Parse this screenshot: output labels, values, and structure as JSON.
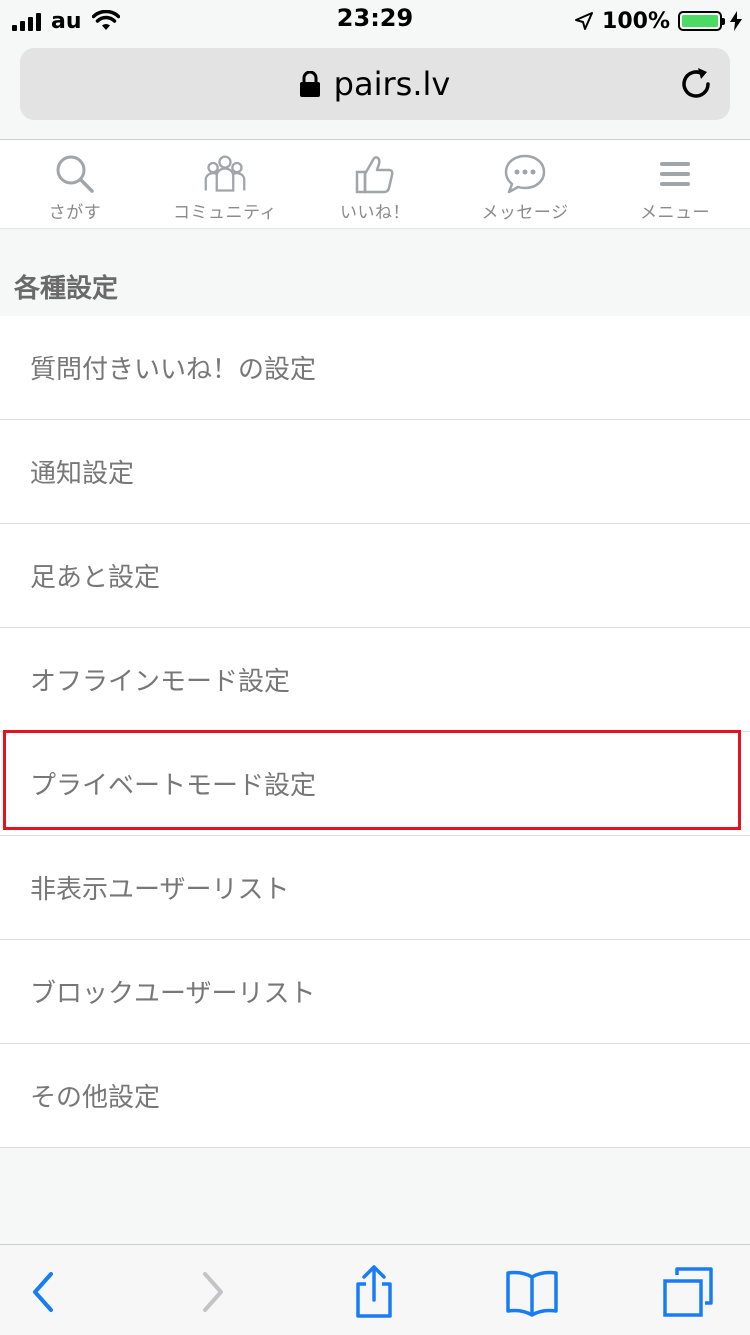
{
  "status_bar": {
    "carrier": "au",
    "time": "23:29",
    "battery_percent": "100%",
    "battery_level": 1.0,
    "battery_color": "#4cd964"
  },
  "browser": {
    "url": "pairs.lv",
    "lock_icon": "lock-icon",
    "reload_icon": "reload-icon"
  },
  "nav": {
    "items": [
      {
        "label": "さがす",
        "icon": "search-icon"
      },
      {
        "label": "コミュニティ",
        "icon": "people-icon"
      },
      {
        "label": "いいね！",
        "icon": "thumbs-up-icon"
      },
      {
        "label": "メッセージ",
        "icon": "chat-bubble-icon"
      },
      {
        "label": "メニュー",
        "icon": "hamburger-icon"
      }
    ]
  },
  "settings": {
    "section_title": "各種設定",
    "items": [
      {
        "label": "質問付きいいね！の設定"
      },
      {
        "label": "通知設定"
      },
      {
        "label": "足あと設定"
      },
      {
        "label": "オフラインモード設定"
      },
      {
        "label": "プライベートモード設定",
        "highlighted": true
      },
      {
        "label": "非表示ユーザーリスト"
      },
      {
        "label": "ブロックユーザーリスト"
      },
      {
        "label": "その他設定"
      }
    ]
  },
  "colors": {
    "ios_blue": "#1a7cf5",
    "highlight_red": "#e3141f",
    "nav_gray": "#9aa0a6"
  },
  "toolbar": {
    "icons": [
      "back-icon",
      "forward-icon",
      "share-icon",
      "bookmarks-icon",
      "tabs-icon"
    ]
  }
}
